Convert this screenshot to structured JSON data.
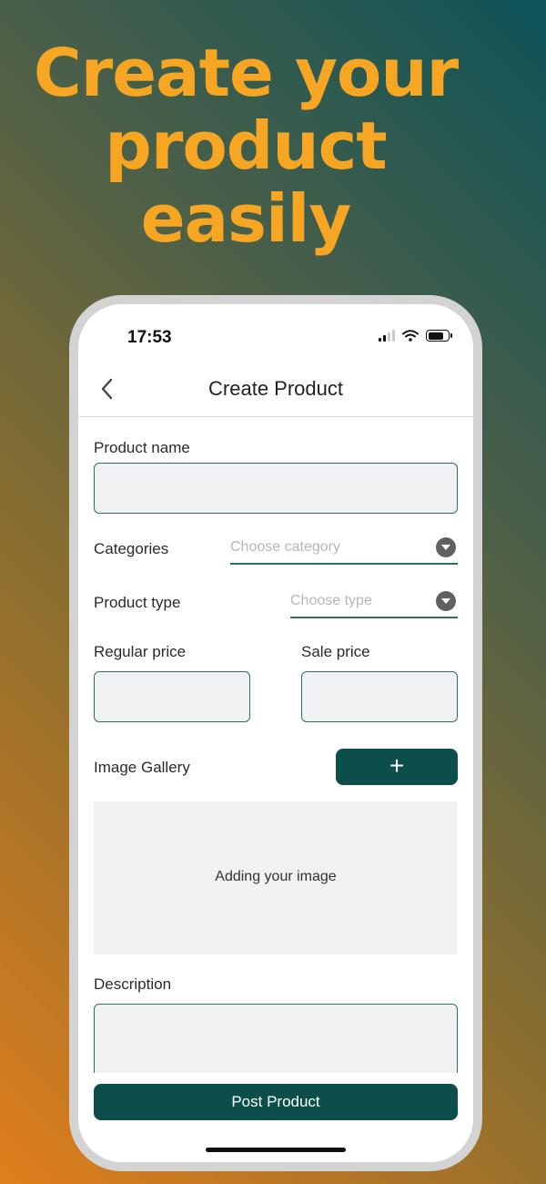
{
  "headline": {
    "line1": "Create your",
    "line2": "product",
    "line3": "easily",
    "color": "#f6a623"
  },
  "status_bar": {
    "time": "17:53"
  },
  "header": {
    "title": "Create Product"
  },
  "form": {
    "product_name_label": "Product name",
    "categories_label": "Categories",
    "categories_placeholder": "Choose category",
    "product_type_label": "Product type",
    "product_type_placeholder": "Choose type",
    "regular_price_label": "Regular price",
    "sale_price_label": "Sale price",
    "image_gallery_label": "Image Gallery",
    "add_image_label": "+",
    "gallery_placeholder": "Adding your image",
    "description_label": "Description",
    "post_button_label": "Post Product"
  },
  "colors": {
    "accent": "#0b4e4a",
    "field_border": "#2f6f68",
    "field_bg": "#f0f1f3"
  }
}
